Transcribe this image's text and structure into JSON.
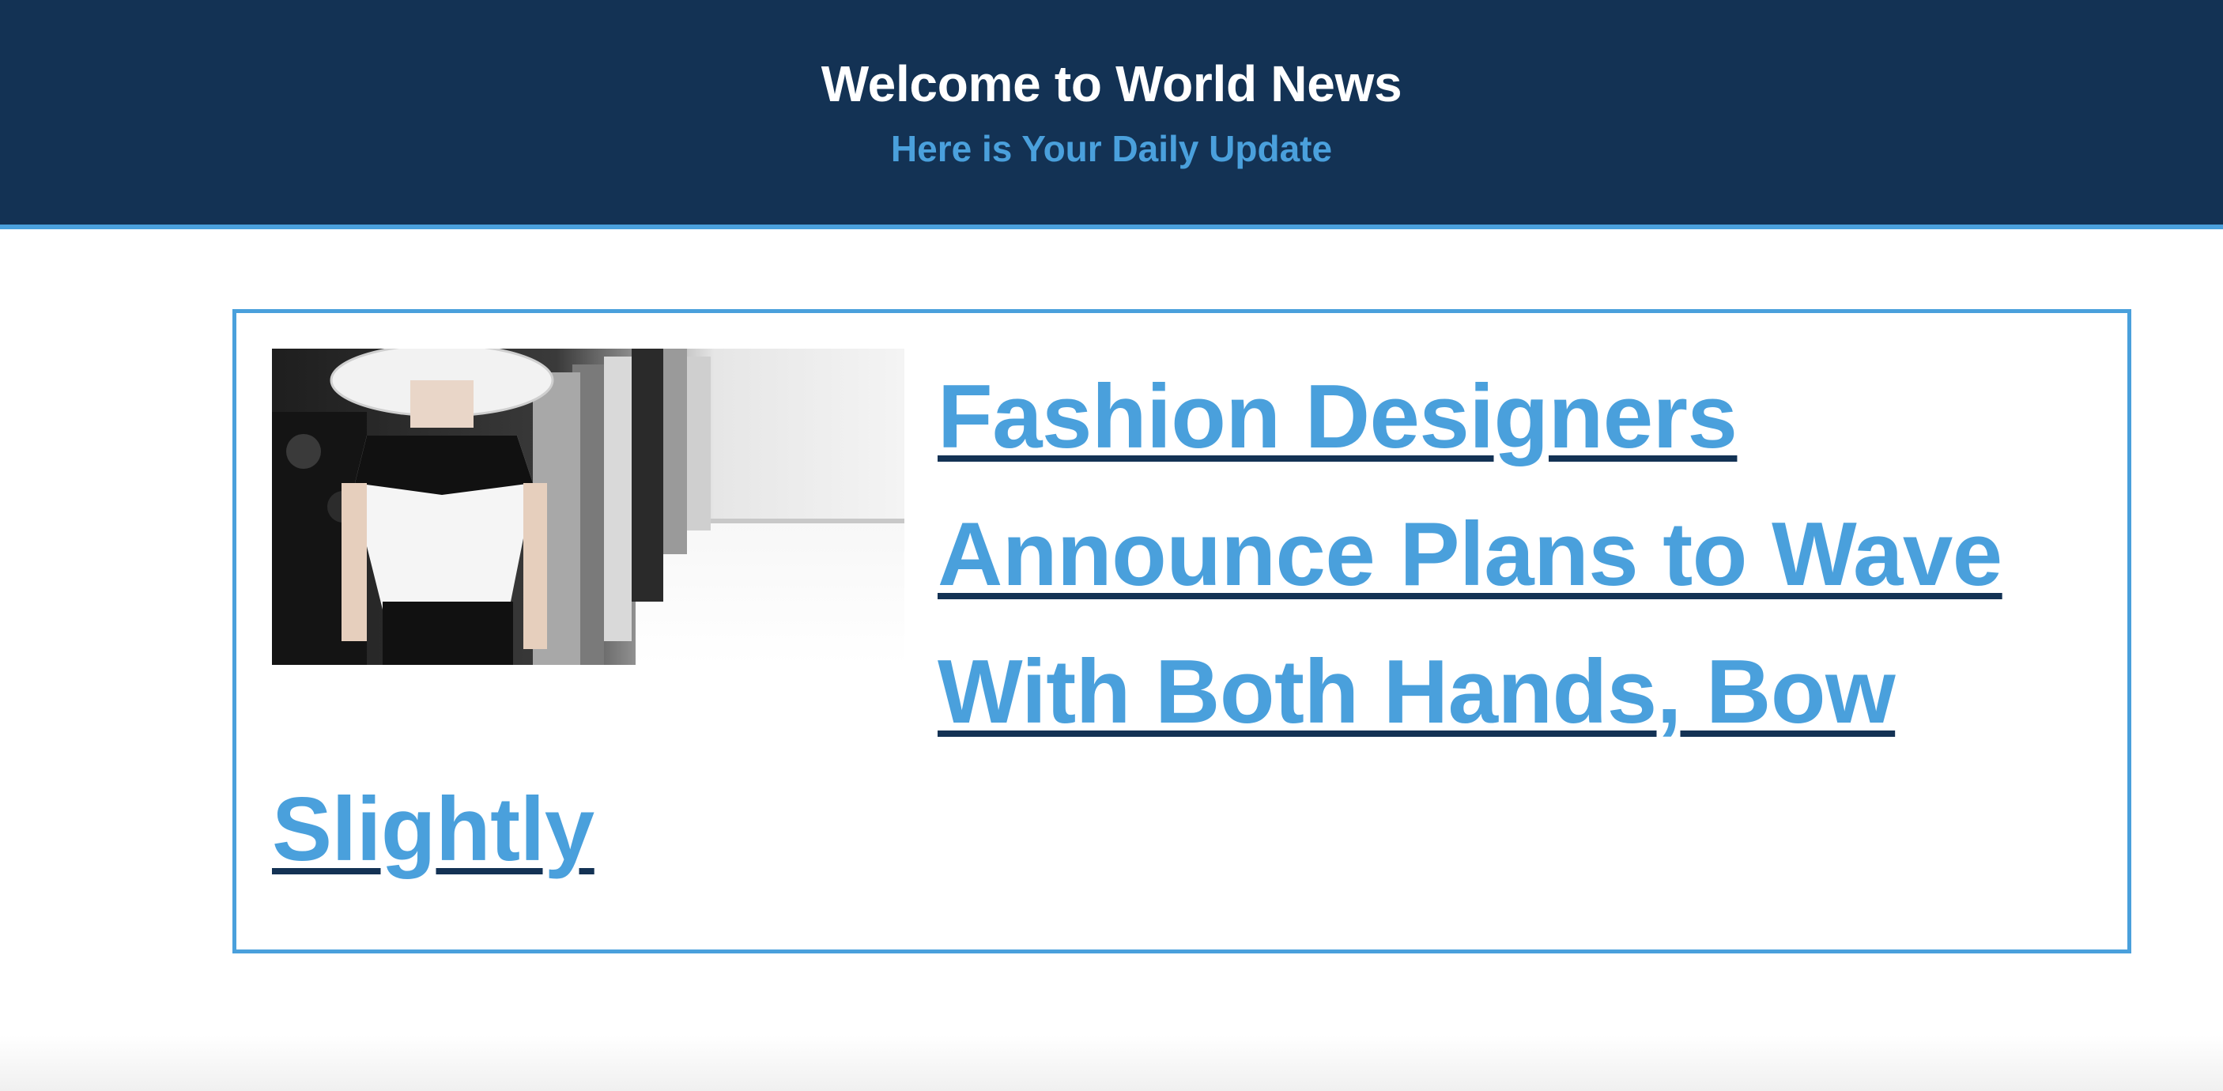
{
  "header": {
    "title": "Welcome to World News",
    "subtitle": "Here is Your Daily Update"
  },
  "article": {
    "headline": "Fashion Designers Announce Plans to Wave With Both Hands, Bow Slightly",
    "image_icon": "fashion-runway-photo"
  },
  "colors": {
    "header_bg": "#133254",
    "accent": "#4aa0dc",
    "link_underline": "#133254"
  }
}
